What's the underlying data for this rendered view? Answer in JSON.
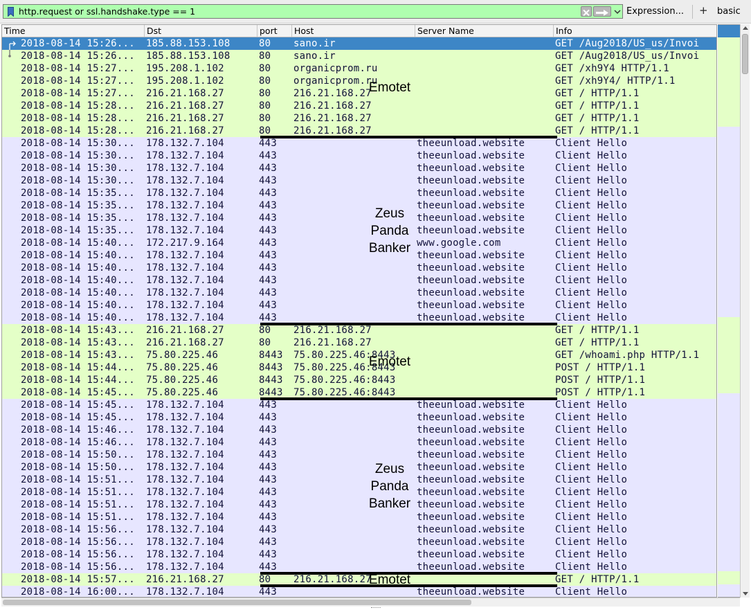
{
  "filter": {
    "text": "http.request or ssl.handshake.type == 1",
    "expression_label": "Expression...",
    "add_label": "+",
    "basic_label": "basic"
  },
  "columns": [
    "Time",
    "Dst",
    "port",
    "Host",
    "Server Name",
    "Info"
  ],
  "rows": [
    {
      "time": "2018-08-14 15:26...",
      "dst": "185.88.153.108",
      "port": "80",
      "host": "sano.ir",
      "server": "",
      "info": "GET /Aug2018/US_us/Invoi",
      "type": "http",
      "selected": true
    },
    {
      "time": "2018-08-14 15:26...",
      "dst": "185.88.153.108",
      "port": "80",
      "host": "sano.ir",
      "server": "",
      "info": "GET /Aug2018/US_us/Invoi",
      "type": "http"
    },
    {
      "time": "2018-08-14 15:27...",
      "dst": "195.208.1.102",
      "port": "80",
      "host": "organicprom.ru",
      "server": "",
      "info": "GET /xh9Y4 HTTP/1.1",
      "type": "http"
    },
    {
      "time": "2018-08-14 15:27...",
      "dst": "195.208.1.102",
      "port": "80",
      "host": "organicprom.ru",
      "server": "",
      "info": "GET /xh9Y4/ HTTP/1.1",
      "type": "http"
    },
    {
      "time": "2018-08-14 15:27...",
      "dst": "216.21.168.27",
      "port": "80",
      "host": "216.21.168.27",
      "server": "",
      "info": "GET / HTTP/1.1",
      "type": "http"
    },
    {
      "time": "2018-08-14 15:28...",
      "dst": "216.21.168.27",
      "port": "80",
      "host": "216.21.168.27",
      "server": "",
      "info": "GET / HTTP/1.1",
      "type": "http"
    },
    {
      "time": "2018-08-14 15:28...",
      "dst": "216.21.168.27",
      "port": "80",
      "host": "216.21.168.27",
      "server": "",
      "info": "GET / HTTP/1.1",
      "type": "http"
    },
    {
      "time": "2018-08-14 15:28...",
      "dst": "216.21.168.27",
      "port": "80",
      "host": "216.21.168.27",
      "server": "",
      "info": "GET / HTTP/1.1",
      "type": "http"
    },
    {
      "time": "2018-08-14 15:30...",
      "dst": "178.132.7.104",
      "port": "443",
      "host": "",
      "server": "theeunload.website",
      "info": "Client Hello",
      "type": "ssl"
    },
    {
      "time": "2018-08-14 15:30...",
      "dst": "178.132.7.104",
      "port": "443",
      "host": "",
      "server": "theeunload.website",
      "info": "Client Hello",
      "type": "ssl"
    },
    {
      "time": "2018-08-14 15:30...",
      "dst": "178.132.7.104",
      "port": "443",
      "host": "",
      "server": "theeunload.website",
      "info": "Client Hello",
      "type": "ssl"
    },
    {
      "time": "2018-08-14 15:30...",
      "dst": "178.132.7.104",
      "port": "443",
      "host": "",
      "server": "theeunload.website",
      "info": "Client Hello",
      "type": "ssl"
    },
    {
      "time": "2018-08-14 15:35...",
      "dst": "178.132.7.104",
      "port": "443",
      "host": "",
      "server": "theeunload.website",
      "info": "Client Hello",
      "type": "ssl"
    },
    {
      "time": "2018-08-14 15:35...",
      "dst": "178.132.7.104",
      "port": "443",
      "host": "",
      "server": "theeunload.website",
      "info": "Client Hello",
      "type": "ssl"
    },
    {
      "time": "2018-08-14 15:35...",
      "dst": "178.132.7.104",
      "port": "443",
      "host": "",
      "server": "theeunload.website",
      "info": "Client Hello",
      "type": "ssl"
    },
    {
      "time": "2018-08-14 15:35...",
      "dst": "178.132.7.104",
      "port": "443",
      "host": "",
      "server": "theeunload.website",
      "info": "Client Hello",
      "type": "ssl"
    },
    {
      "time": "2018-08-14 15:40...",
      "dst": "172.217.9.164",
      "port": "443",
      "host": "",
      "server": "www.google.com",
      "info": "Client Hello",
      "type": "ssl"
    },
    {
      "time": "2018-08-14 15:40...",
      "dst": "178.132.7.104",
      "port": "443",
      "host": "",
      "server": "theeunload.website",
      "info": "Client Hello",
      "type": "ssl"
    },
    {
      "time": "2018-08-14 15:40...",
      "dst": "178.132.7.104",
      "port": "443",
      "host": "",
      "server": "theeunload.website",
      "info": "Client Hello",
      "type": "ssl"
    },
    {
      "time": "2018-08-14 15:40...",
      "dst": "178.132.7.104",
      "port": "443",
      "host": "",
      "server": "theeunload.website",
      "info": "Client Hello",
      "type": "ssl"
    },
    {
      "time": "2018-08-14 15:40...",
      "dst": "178.132.7.104",
      "port": "443",
      "host": "",
      "server": "theeunload.website",
      "info": "Client Hello",
      "type": "ssl"
    },
    {
      "time": "2018-08-14 15:40...",
      "dst": "178.132.7.104",
      "port": "443",
      "host": "",
      "server": "theeunload.website",
      "info": "Client Hello",
      "type": "ssl"
    },
    {
      "time": "2018-08-14 15:40...",
      "dst": "178.132.7.104",
      "port": "443",
      "host": "",
      "server": "theeunload.website",
      "info": "Client Hello",
      "type": "ssl"
    },
    {
      "time": "2018-08-14 15:43...",
      "dst": "216.21.168.27",
      "port": "80",
      "host": "216.21.168.27",
      "server": "",
      "info": "GET / HTTP/1.1",
      "type": "http"
    },
    {
      "time": "2018-08-14 15:43...",
      "dst": "216.21.168.27",
      "port": "80",
      "host": "216.21.168.27",
      "server": "",
      "info": "GET / HTTP/1.1",
      "type": "http"
    },
    {
      "time": "2018-08-14 15:43...",
      "dst": "75.80.225.46",
      "port": "8443",
      "host": "75.80.225.46:8443",
      "server": "",
      "info": "GET /whoami.php HTTP/1.1",
      "type": "http"
    },
    {
      "time": "2018-08-14 15:44...",
      "dst": "75.80.225.46",
      "port": "8443",
      "host": "75.80.225.46:8443",
      "server": "",
      "info": "POST / HTTP/1.1",
      "type": "http"
    },
    {
      "time": "2018-08-14 15:44...",
      "dst": "75.80.225.46",
      "port": "8443",
      "host": "75.80.225.46:8443",
      "server": "",
      "info": "POST / HTTP/1.1",
      "type": "http"
    },
    {
      "time": "2018-08-14 15:45...",
      "dst": "75.80.225.46",
      "port": "8443",
      "host": "75.80.225.46:8443",
      "server": "",
      "info": "POST / HTTP/1.1",
      "type": "http"
    },
    {
      "time": "2018-08-14 15:45...",
      "dst": "178.132.7.104",
      "port": "443",
      "host": "",
      "server": "theeunload.website",
      "info": "Client Hello",
      "type": "ssl"
    },
    {
      "time": "2018-08-14 15:45...",
      "dst": "178.132.7.104",
      "port": "443",
      "host": "",
      "server": "theeunload.website",
      "info": "Client Hello",
      "type": "ssl"
    },
    {
      "time": "2018-08-14 15:46...",
      "dst": "178.132.7.104",
      "port": "443",
      "host": "",
      "server": "theeunload.website",
      "info": "Client Hello",
      "type": "ssl"
    },
    {
      "time": "2018-08-14 15:46...",
      "dst": "178.132.7.104",
      "port": "443",
      "host": "",
      "server": "theeunload.website",
      "info": "Client Hello",
      "type": "ssl"
    },
    {
      "time": "2018-08-14 15:50...",
      "dst": "178.132.7.104",
      "port": "443",
      "host": "",
      "server": "theeunload.website",
      "info": "Client Hello",
      "type": "ssl"
    },
    {
      "time": "2018-08-14 15:50...",
      "dst": "178.132.7.104",
      "port": "443",
      "host": "",
      "server": "theeunload.website",
      "info": "Client Hello",
      "type": "ssl"
    },
    {
      "time": "2018-08-14 15:51...",
      "dst": "178.132.7.104",
      "port": "443",
      "host": "",
      "server": "theeunload.website",
      "info": "Client Hello",
      "type": "ssl"
    },
    {
      "time": "2018-08-14 15:51...",
      "dst": "178.132.7.104",
      "port": "443",
      "host": "",
      "server": "theeunload.website",
      "info": "Client Hello",
      "type": "ssl"
    },
    {
      "time": "2018-08-14 15:51...",
      "dst": "178.132.7.104",
      "port": "443",
      "host": "",
      "server": "theeunload.website",
      "info": "Client Hello",
      "type": "ssl"
    },
    {
      "time": "2018-08-14 15:51...",
      "dst": "178.132.7.104",
      "port": "443",
      "host": "",
      "server": "theeunload.website",
      "info": "Client Hello",
      "type": "ssl"
    },
    {
      "time": "2018-08-14 15:56...",
      "dst": "178.132.7.104",
      "port": "443",
      "host": "",
      "server": "theeunload.website",
      "info": "Client Hello",
      "type": "ssl"
    },
    {
      "time": "2018-08-14 15:56...",
      "dst": "178.132.7.104",
      "port": "443",
      "host": "",
      "server": "theeunload.website",
      "info": "Client Hello",
      "type": "ssl"
    },
    {
      "time": "2018-08-14 15:56...",
      "dst": "178.132.7.104",
      "port": "443",
      "host": "",
      "server": "theeunload.website",
      "info": "Client Hello",
      "type": "ssl"
    },
    {
      "time": "2018-08-14 15:56...",
      "dst": "178.132.7.104",
      "port": "443",
      "host": "",
      "server": "theeunload.website",
      "info": "Client Hello",
      "type": "ssl"
    },
    {
      "time": "2018-08-14 15:57...",
      "dst": "216.21.168.27",
      "port": "80",
      "host": "216.21.168.27",
      "server": "",
      "info": "GET / HTTP/1.1",
      "type": "http"
    },
    {
      "time": "2018-08-14 16:00...",
      "dst": "178.132.7.104",
      "port": "443",
      "host": "",
      "server": "theeunload.website",
      "info": "Client Hello",
      "type": "ssl"
    }
  ],
  "annotations": [
    {
      "label": "Emotet",
      "first_row": 0,
      "last_row": 7
    },
    {
      "label": "Zeus\nPanda\nBanker",
      "first_row": 8,
      "last_row": 22
    },
    {
      "label": "Emotet",
      "first_row": 23,
      "last_row": 28
    },
    {
      "label": "Zeus\nPanda\nBanker",
      "first_row": 29,
      "last_row": 42
    },
    {
      "label": "Emotet",
      "first_row": 43,
      "last_row": 43
    }
  ],
  "colors": {
    "http_row": "#e4ffc7",
    "ssl_row": "#e7e6ff",
    "selected_row": "#3d86c6",
    "filter_valid": "#afffaf"
  },
  "icons": {
    "bookmark": "bookmark-icon",
    "clear": "clear-icon",
    "apply": "arrow-right-icon",
    "history": "chevron-down-icon",
    "related_first": "related-packet-first-icon",
    "related_next": "related-packet-icon"
  }
}
